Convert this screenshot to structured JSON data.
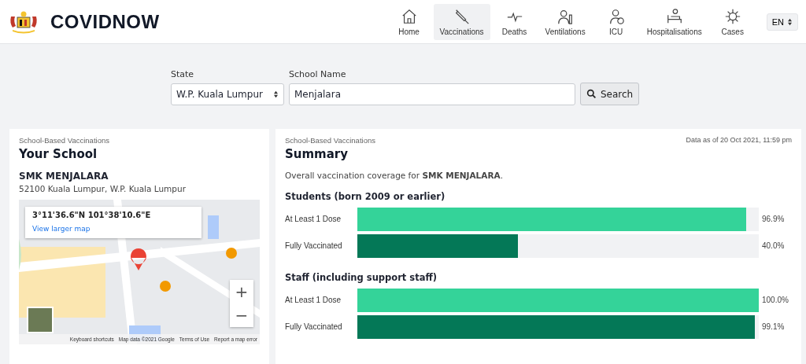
{
  "header": {
    "brand": "COVIDNOW",
    "nav": [
      {
        "label": "Home",
        "selected": false
      },
      {
        "label": "Vaccinations",
        "selected": true
      },
      {
        "label": "Deaths",
        "selected": false
      },
      {
        "label": "Ventilations",
        "selected": false
      },
      {
        "label": "ICU",
        "selected": false
      },
      {
        "label": "Hospitalisations",
        "selected": false
      },
      {
        "label": "Cases",
        "selected": false
      }
    ],
    "language": "EN"
  },
  "search": {
    "state_label": "State",
    "state_value": "W.P. Kuala Lumpur",
    "school_label": "School Name",
    "school_value": "Menjalara",
    "button": "Search"
  },
  "school_card": {
    "eyebrow": "School-Based Vaccinations",
    "title": "Your School",
    "school": "SMK MENJALARA",
    "address": "52100 Kuala Lumpur, W.P. Kuala Lumpur",
    "map": {
      "coordinates": "3°11'36.6\"N 101°38'10.6\"E",
      "link": "View larger map",
      "zoom_in": "+",
      "zoom_out": "−",
      "footer": [
        "Keyboard shortcuts",
        "Map data ©2021 Google",
        "Terms of Use",
        "Report a map error"
      ]
    }
  },
  "summary_card": {
    "eyebrow": "School-Based Vaccinations",
    "title": "Summary",
    "as_of": "Data as of 20 Oct 2021, 11:59 pm",
    "intro": "Overall vaccination coverage for **SMK MENJALARA**.",
    "groups": [
      {
        "heading": "Students (born 2009 or earlier)",
        "bars": [
          {
            "label": "At Least 1 Dose",
            "kind": "partial",
            "level": 0.969,
            "value": "96.9%"
          },
          {
            "label": "Fully Vaccinated",
            "kind": "full",
            "level": 0.4,
            "value": "40.0%"
          }
        ]
      },
      {
        "heading": "Staff (including support staff)",
        "bars": [
          {
            "label": "At Least 1 Dose",
            "kind": "partial",
            "level": 1.0,
            "value": "100.0%"
          },
          {
            "label": "Fully Vaccinated",
            "kind": "full",
            "level": 0.991,
            "value": "99.1%"
          }
        ]
      }
    ]
  }
}
